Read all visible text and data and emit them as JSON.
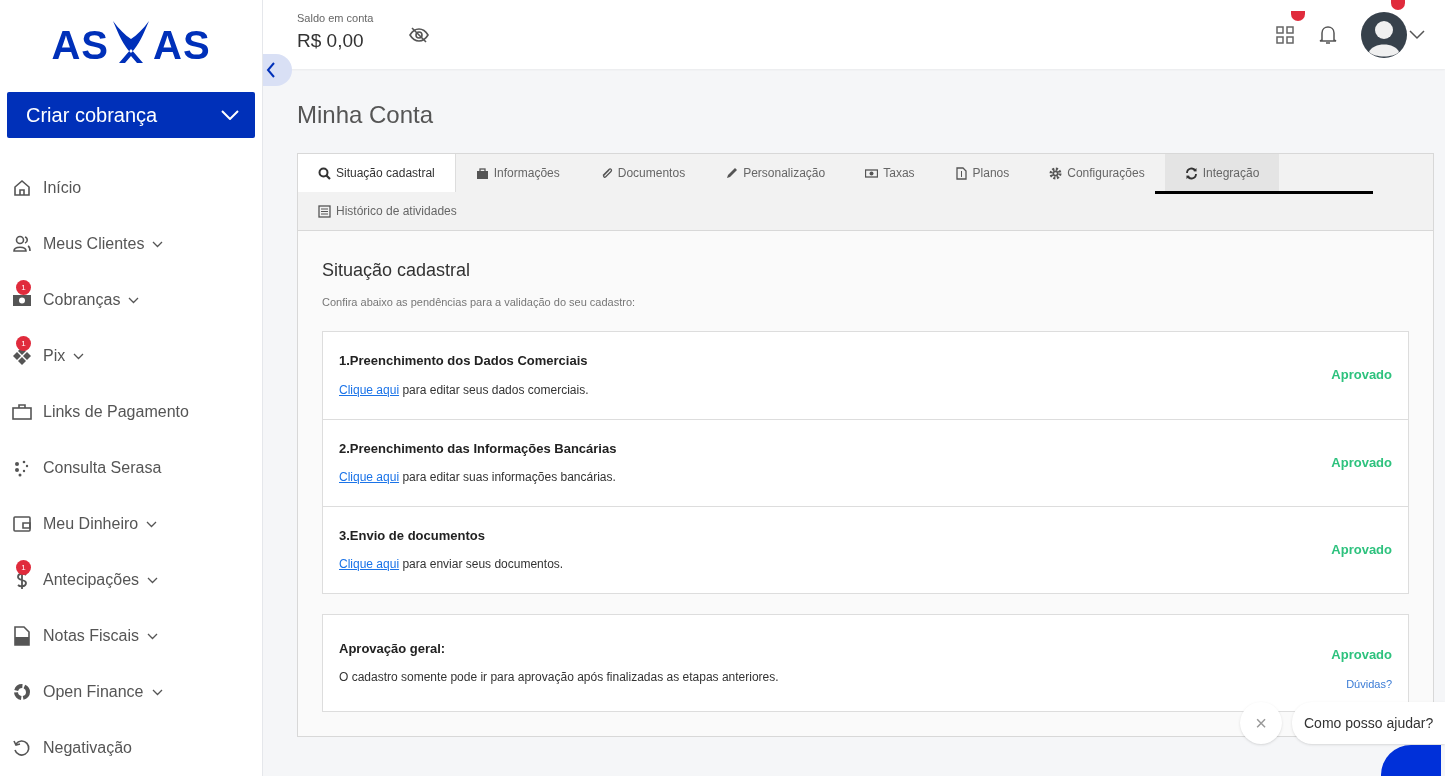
{
  "logo": {
    "left": "AS",
    "right": "AS"
  },
  "create_button": {
    "label": "Criar cobrança"
  },
  "sidebar": {
    "items": [
      {
        "label": "Início",
        "expandable": false
      },
      {
        "label": "Meus Clientes",
        "expandable": true
      },
      {
        "label": "Cobranças",
        "expandable": true,
        "badge": "1"
      },
      {
        "label": "Pix",
        "expandable": true,
        "badge": "1"
      },
      {
        "label": "Links de Pagamento",
        "expandable": false
      },
      {
        "label": "Consulta Serasa",
        "expandable": false
      },
      {
        "label": "Meu Dinheiro",
        "expandable": true
      },
      {
        "label": "Antecipações",
        "expandable": true,
        "badge": "1"
      },
      {
        "label": "Notas Fiscais",
        "expandable": true
      },
      {
        "label": "Open Finance",
        "expandable": true
      },
      {
        "label": "Negativação",
        "expandable": false
      }
    ]
  },
  "header": {
    "balance_label": "Saldo em conta",
    "balance": "R$ 0,00"
  },
  "page_title": "Minha Conta",
  "tabs": [
    {
      "label": "Situação cadastral",
      "selected": true,
      "hovered": false
    },
    {
      "label": "Informações",
      "selected": false,
      "hovered": false
    },
    {
      "label": "Documentos",
      "selected": false,
      "hovered": false
    },
    {
      "label": "Personalização",
      "selected": false,
      "hovered": false
    },
    {
      "label": "Taxas",
      "selected": false,
      "hovered": false
    },
    {
      "label": "Planos",
      "selected": false,
      "hovered": false
    },
    {
      "label": "Configurações",
      "selected": false,
      "hovered": false
    },
    {
      "label": "Integração",
      "selected": false,
      "hovered": true
    },
    {
      "label": "Histórico de atividades",
      "selected": false,
      "hovered": false
    }
  ],
  "section": {
    "title": "Situação cadastral",
    "subtitle": "Confira abaixo as pendências para a validação do seu cadastro:",
    "steps": [
      {
        "title": "1.Preenchimento dos Dados Comerciais",
        "link": "Clique aqui",
        "text": "para editar seus dados comerciais.",
        "status": "Aprovado"
      },
      {
        "title": "2.Preenchimento das Informações Bancárias",
        "link": "Clique aqui",
        "text": "para editar suas informações bancárias.",
        "status": "Aprovado"
      },
      {
        "title": "3.Envio de documentos",
        "link": "Clique aqui",
        "text": "para enviar seus documentos.",
        "status": "Aprovado"
      }
    ],
    "overall": {
      "title": "Aprovação geral:",
      "text": "O cadastro somente pode ir para aprovação após finalizadas as etapas anteriores.",
      "status": "Aprovado",
      "help_link": "Dúvidas?"
    }
  },
  "chat": {
    "close": "×",
    "message": "Como posso ajudar?"
  }
}
